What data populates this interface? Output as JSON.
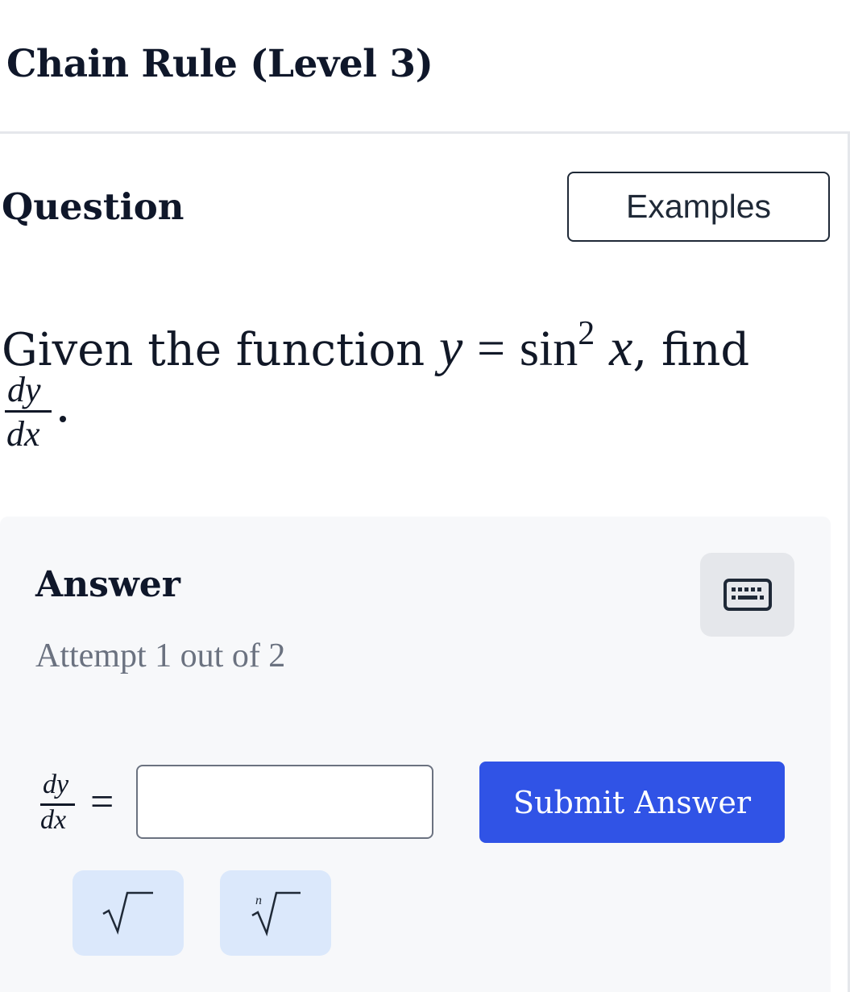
{
  "header": {
    "title": "Chain Rule (Level 3)"
  },
  "question": {
    "heading": "Question",
    "examples_label": "Examples",
    "prompt_prefix": "Given the function",
    "function_lhs": "y",
    "equals": "=",
    "function_name": "sin",
    "function_exponent": "2",
    "function_arg": "x",
    "prompt_suffix": ", find",
    "derivative_numerator": "dy",
    "derivative_denominator": "dx"
  },
  "answer": {
    "heading": "Answer",
    "keyboard_icon": "keyboard-icon",
    "attempt_text": "Attempt 1 out of 2",
    "lhs_numerator": "dy",
    "lhs_denominator": "dx",
    "equals": "=",
    "input_value": "",
    "input_placeholder": "",
    "submit_label": "Submit Answer",
    "math_keys": [
      {
        "name": "square-root",
        "icon": "square-root-icon"
      },
      {
        "name": "nth-root",
        "icon": "nth-root-icon",
        "index_label": "n"
      }
    ]
  },
  "colors": {
    "submit_bg": "#3053e6",
    "panel_bg": "#f7f8fa",
    "math_key_bg": "#dbe8fb",
    "keyboard_bg": "#e5e7eb",
    "muted_text": "#6b7280"
  }
}
